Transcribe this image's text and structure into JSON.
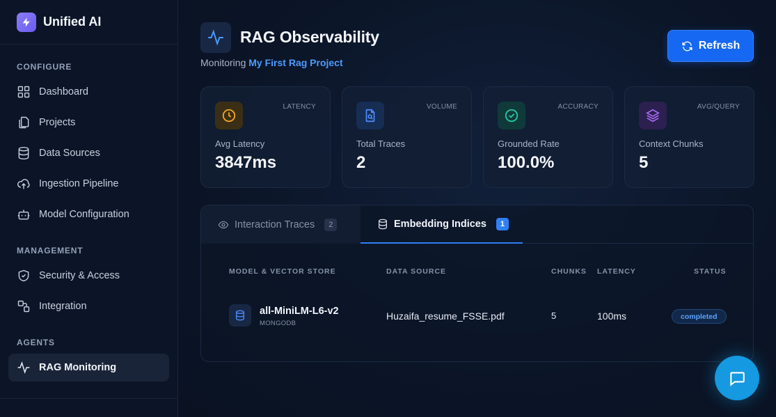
{
  "brand": {
    "name": "Unified AI",
    "logo_icon": "bolt-icon"
  },
  "sidebar": {
    "sections": [
      {
        "title": "CONFIGURE"
      },
      {
        "title": "MANAGEMENT"
      },
      {
        "title": "AGENTS"
      }
    ],
    "items": [
      {
        "label": "Dashboard",
        "icon": "grid-icon"
      },
      {
        "label": "Projects",
        "icon": "files-icon"
      },
      {
        "label": "Data Sources",
        "icon": "database-icon"
      },
      {
        "label": "Ingestion Pipeline",
        "icon": "cloud-upload-icon"
      },
      {
        "label": "Model Configuration",
        "icon": "robot-icon"
      },
      {
        "label": "Security & Access",
        "icon": "shield-icon"
      },
      {
        "label": "Integration",
        "icon": "integration-icon"
      },
      {
        "label": "RAG Monitoring",
        "icon": "activity-icon",
        "active": true
      }
    ]
  },
  "header": {
    "title": "RAG Observability",
    "subtitle_prefix": "Monitoring",
    "project_name": "My First Rag Project",
    "refresh_label": "Refresh"
  },
  "stats": [
    {
      "tag": "LATENCY",
      "label": "Avg Latency",
      "value": "3847ms",
      "icon": "clock-icon",
      "color": "#f5a623"
    },
    {
      "tag": "VOLUME",
      "label": "Total Traces",
      "value": "2",
      "icon": "file-search-icon",
      "color": "#4d8dff"
    },
    {
      "tag": "ACCURACY",
      "label": "Grounded Rate",
      "value": "100.0%",
      "icon": "check-circle-icon",
      "color": "#22c9a4"
    },
    {
      "tag": "AVG/QUERY",
      "label": "Context Chunks",
      "value": "5",
      "icon": "layers-icon",
      "color": "#a76cf5"
    }
  ],
  "tabs": [
    {
      "label": "Interaction Traces",
      "count": "2",
      "icon": "eye-icon",
      "active": false
    },
    {
      "label": "Embedding Indices",
      "count": "1",
      "icon": "database-icon",
      "active": true
    }
  ],
  "table": {
    "headers": [
      "MODEL & VECTOR STORE",
      "DATA SOURCE",
      "CHUNKS",
      "LATENCY",
      "STATUS"
    ],
    "rows": [
      {
        "model": "all-MiniLM-L6-v2",
        "store": "MONGODB",
        "source": "Huzaifa_resume_FSSE.pdf",
        "chunks": "5",
        "latency": "100ms",
        "status": "completed"
      }
    ]
  },
  "chat": {
    "icon": "chat-bubble-icon"
  },
  "colors": {
    "accent": "#1668f2",
    "link": "#4d9bff",
    "fab": "#1599e0"
  }
}
